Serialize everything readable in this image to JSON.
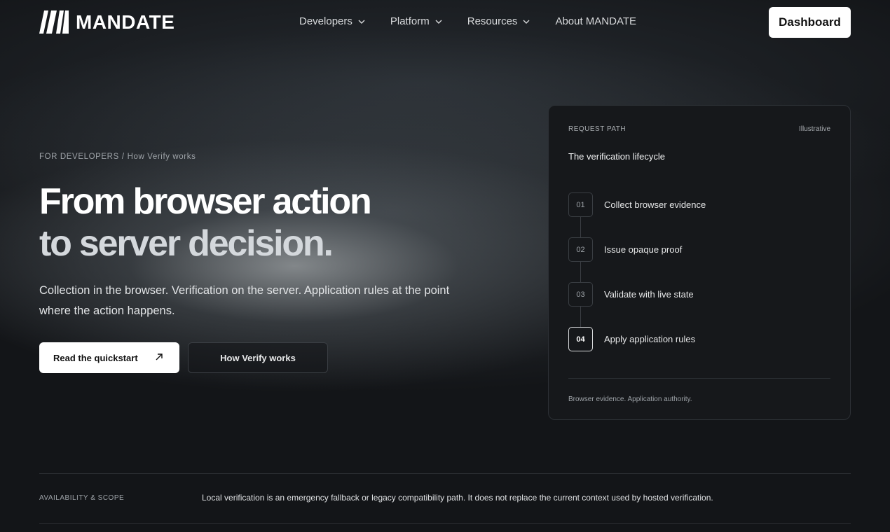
{
  "nav": {
    "logo_text": "MANDATE",
    "items": [
      {
        "label": "Developers",
        "has_dropdown": true
      },
      {
        "label": "Platform",
        "has_dropdown": true
      },
      {
        "label": "Resources",
        "has_dropdown": true
      },
      {
        "label": "About MANDATE",
        "has_dropdown": false
      }
    ],
    "dashboard_label": "Dashboard"
  },
  "hero": {
    "breadcrumb_section": "FOR DEVELOPERS",
    "breadcrumb_separator": "/",
    "breadcrumb_page": "How Verify works",
    "headline_line1": "From browser action",
    "headline_line2": "to server decision.",
    "lede": "Collection in the browser. Verification on the server. Application rules at the point where the action happens.",
    "primary_button": "Read the quickstart",
    "secondary_button": "How Verify works"
  },
  "card": {
    "label": "REQUEST PATH",
    "tag": "Illustrative",
    "title": "The verification lifecycle",
    "steps": [
      {
        "num": "01",
        "text": "Collect browser evidence"
      },
      {
        "num": "02",
        "text": "Issue opaque proof"
      },
      {
        "num": "03",
        "text": "Validate with live state"
      },
      {
        "num": "04",
        "text": "Apply application rules"
      }
    ],
    "footer": "Browser evidence. Application authority."
  },
  "scope": {
    "label": "AVAILABILITY & SCOPE",
    "text": "Local verification is an emergency fallback or legacy compatibility path. It does not replace the current context used by hosted verification."
  },
  "colors": {
    "background": "#131518",
    "card_bg": "#16181b",
    "border": "#2c3035",
    "primary_button_bg": "#ffffff"
  }
}
